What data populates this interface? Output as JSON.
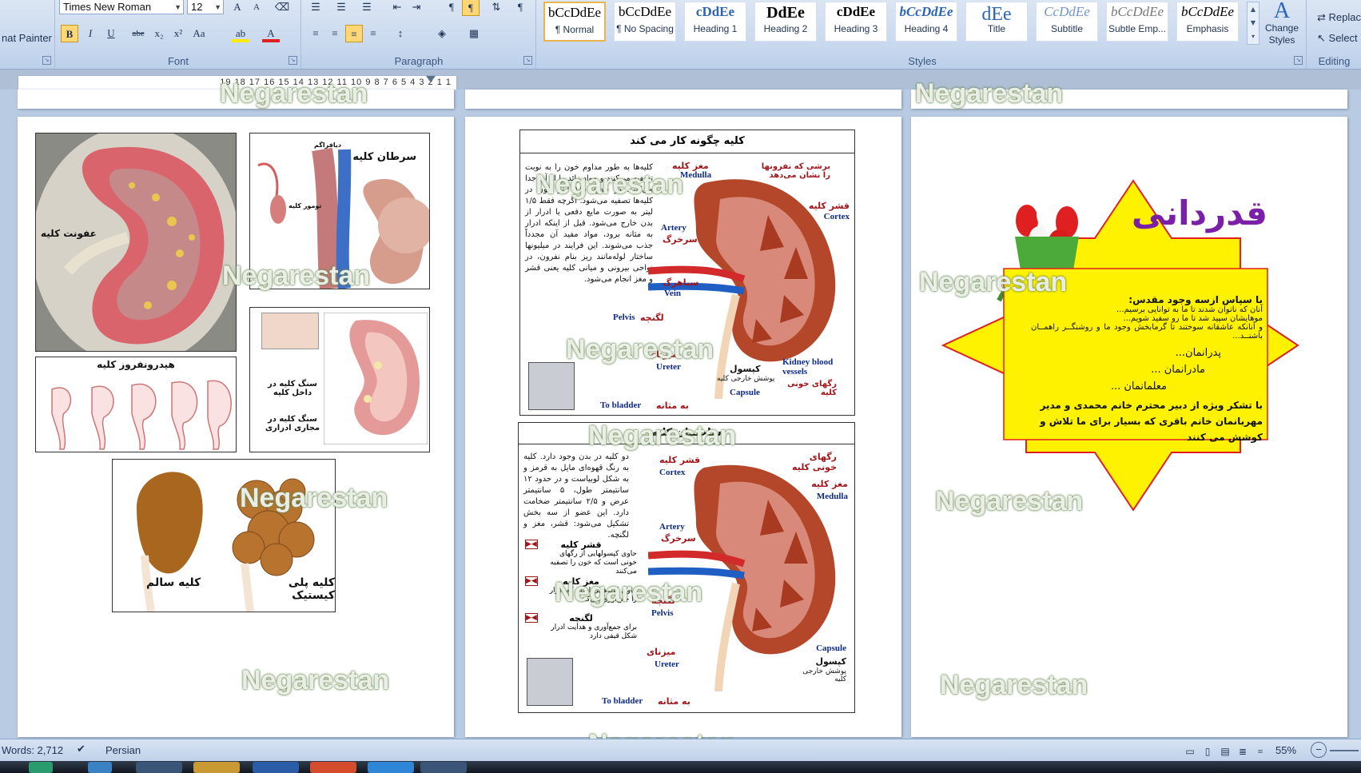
{
  "ribbon": {
    "clipboard": {
      "format_painter_label": "Format Painter",
      "format_painter_visible": "nat Painter"
    },
    "font": {
      "group_label": "Font",
      "font_name": "Times New Roman",
      "font_size": "12",
      "buttons": [
        "B",
        "I",
        "U",
        "abe",
        "x₂",
        "x²",
        "Aa"
      ]
    },
    "paragraph": {
      "group_label": "Paragraph"
    },
    "styles": {
      "group_label": "Styles",
      "tiles": [
        {
          "preview": "AaBbCcDdEe",
          "name": "¶ Normal"
        },
        {
          "preview": "AaBbCcDdEe",
          "name": "¶ No Spacing"
        },
        {
          "preview": "AaBbCcDdEe",
          "name": "Heading 1"
        },
        {
          "preview": "AaBbCcDdEe",
          "name": "Heading 2"
        },
        {
          "preview": "AaBbCcDdEe",
          "name": "Heading 3"
        },
        {
          "preview": "AaBbCcDdEe",
          "name": "Heading 4"
        },
        {
          "preview": "AaBbCcDdEe",
          "name": "Title"
        },
        {
          "preview": "AaBbCcDdEe",
          "name": "Subtitle"
        },
        {
          "preview": "AaBbCcDdEe",
          "name": "Subtle Emp..."
        },
        {
          "preview": "AaBbCcDdEe",
          "name": "Emphasis"
        }
      ],
      "visible_previews": [
        "bCcDdEe",
        "bCcDdEe",
        "cDdEe",
        "DdEe",
        "cDdEe",
        "bCcDdEe",
        "dEe",
        "CcDdEe",
        "bCcDdEe",
        "bCcDdEe"
      ],
      "change_styles_label": "Change Styles"
    },
    "editing": {
      "group_label": "Editing",
      "replace_label": "Replace",
      "select_label": "Select"
    }
  },
  "ruler": {
    "numbers": "19 18 17 16 15 14 13 12 11 10 9 8 7 6 5 4 3 2 1 1"
  },
  "left_page": {
    "captions": {
      "infection": "عفونت کلیه",
      "cancer": "سرطان کلیه",
      "hydro": "هیدرونفروز کلیه",
      "stone_inside": "سنگ کلیه در داخل کلیه",
      "stone_tract": "سنگ کلیه در مجاری ادراری",
      "healthy": "کلیه سالم",
      "polycystic": "کلیه پلی کیستیک",
      "diaphragm": "دیافراگم",
      "tumor": "تومور کلیه"
    }
  },
  "middle_page": {
    "top_diagram": {
      "title": "کلیه چگونه کار می کند",
      "body": "کلیه‌ها به طور مداوم خون را به نوبت تصفیه می‌کنند و مواد زائد را از آن جدا می‌کنند. در حدود ۱۸۰ لیتر خون در کلیه‌ها تصفیه می‌شود. اگرچه فقط ۱/۵ لیتر به صورت مایع دفعی یا ادرار از بدن خارج می‌شود. قبل از اینکه ادرار به مثانه برود، مواد مفید آن مجدداً جذب می‌شوند. این فرایند در میلیونها ساختار لوله‌مانند ریز بنام نفرون، در نواحی بیرونی و میانی کلیه یعنی قشر و مغز انجام می‌شود.",
      "labels": {
        "medulla_fa": "مغز کلیه",
        "medulla_en": "Medulla",
        "nephron_note": "برشی که نفرونها را نشان می‌دهد",
        "cortex_fa": "قشر کلیه",
        "cortex_en": "Cortex",
        "artery_en": "Artery",
        "artery_fa": "سرخرگ",
        "vein_fa": "سیاهرگ",
        "vein_en": "Vein",
        "pelvis_en": "Pelvis",
        "pelvis_fa": "لگنچه",
        "ureter_fa": "میزنای",
        "ureter_en": "Ureter",
        "capsule_fa": "کپسول",
        "capsule_note": "پوشش خارجی کلیه",
        "capsule_en": "Capsule",
        "vessels_en": "Kidney blood vessels",
        "vessels_fa": "رگهای خونی کلیه",
        "bladder_en": "To bladder",
        "bladder_fa": "به مثانه"
      }
    },
    "bottom_diagram": {
      "title": "ساختمان کلیه",
      "body": "دو کلیه در بدن وجود دارد. کلیه به رنگ قهوه‌ای مایل به قرمز و به شکل لوبیاست و در حدود ۱۲ سانتیمتر طول، ۵ سانتیمتر عرض و ۲/۵ سانتیمتر ضخامت دارد. این عضو از سه بخش تشکیل می‌شود: قشر، مغز و لگنچه.",
      "legend": [
        {
          "title": "قشر کلیه",
          "text": "حاوی کپسولهایی از رگهای خونی است که خون را تصفیه می‌کنند"
        },
        {
          "title": "مغز کلیه",
          "text": "حاوی لوله‌هایی است که ادرار را جمع‌آوری می‌کنند"
        },
        {
          "title": "لگنچه",
          "text": "برای جمع‌آوری و هدایت ادرار شکل قیفی دارد"
        }
      ],
      "labels": {
        "vessels_fa": "رگهای خونی کلیه",
        "cortex_fa": "قشر کلیه",
        "cortex_en": "Cortex",
        "medulla_fa": "مغز کلیه",
        "medulla_en": "Medulla",
        "artery_en": "Artery",
        "artery_fa": "سرخرگ",
        "pelvis_fa": "لگنچه",
        "pelvis_en": "Pelvis",
        "ureter_fa": "میزنای",
        "ureter_en": "Ureter",
        "capsule_en": "Capsule",
        "capsule_fa": "کپسول",
        "capsule_note": "پوشش خارجی کلیه",
        "bladder_en": "To bladder",
        "bladder_fa": "به مثانه"
      }
    }
  },
  "right_page": {
    "title": "قدردانی",
    "lines": [
      "با سپاس ازسه وجود مقدس:",
      "آنان که ناتوان شدند تا ما به توانایی برسیم...",
      "موهایشان سپید شد تا ما رو سفید شویم...",
      "و آنانکه عاشقانه سوختند تا گرمابخش وجود ما و روشنگــر راهمــان باشنــد...",
      "پدرانمان...",
      "مادرانمان ...",
      "معلمانمان ...",
      "با تشکر ویژه از دبیر محترم خانم محمدی و مدیر مهربانمان خانم باقری که بسیار برای ما تلاش و کوشش می کنند"
    ]
  },
  "watermark_text": "Negarestan",
  "statusbar": {
    "words": "Words: 2,712",
    "language": "Persian",
    "zoom": "55%"
  },
  "colors": {
    "star_fill": "#fff200",
    "star_border": "#e02020",
    "title_purple": "#7a1fa8",
    "kidney_red": "#b4472a",
    "artery": "#d22a2a",
    "vein": "#1f5fc4"
  }
}
